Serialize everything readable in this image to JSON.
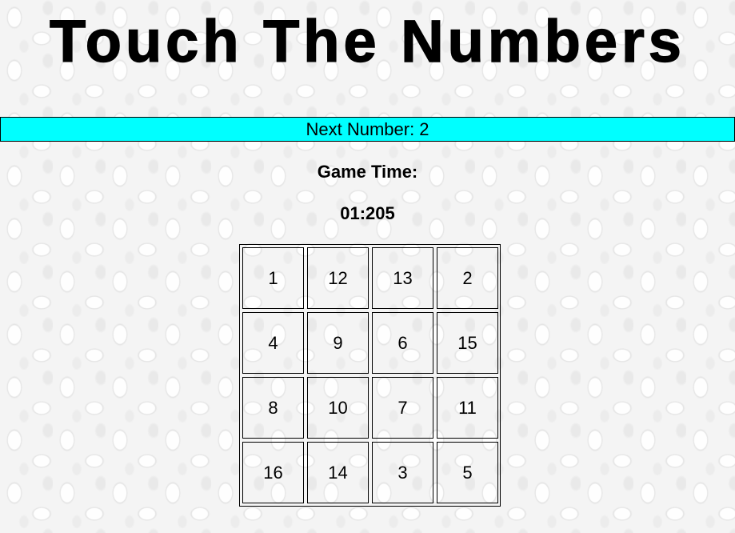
{
  "title": "Touch The Numbers",
  "next_number_label": "Next Number: 2",
  "game_time_label": "Game Time:",
  "game_time_value": "01:205",
  "colors": {
    "next_bar": "#00ffff",
    "text": "#000000",
    "background": "#f4f4f4"
  },
  "grid": {
    "cells": [
      "1",
      "12",
      "13",
      "2",
      "4",
      "9",
      "6",
      "15",
      "8",
      "10",
      "7",
      "11",
      "16",
      "14",
      "3",
      "5"
    ]
  }
}
